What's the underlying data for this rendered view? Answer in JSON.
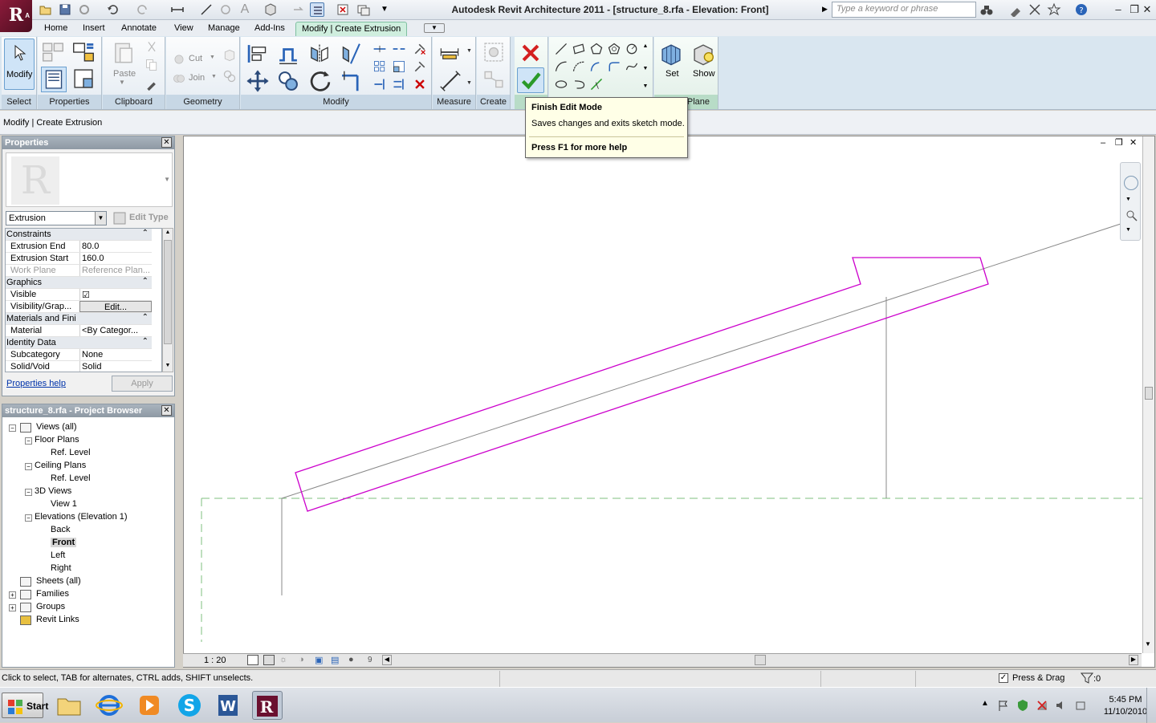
{
  "window": {
    "title": "Autodesk Revit Architecture 2011 - [structure_8.rfa - Elevation: Front]",
    "search_placeholder": "Type a keyword or phrase",
    "logo_letter": "R",
    "logo_sub": "A"
  },
  "tabs": [
    "Home",
    "Insert",
    "Annotate",
    "View",
    "Manage",
    "Add-Ins",
    "Modify | Create Extrusion"
  ],
  "ribbon": {
    "panels": [
      "Select",
      "Properties",
      "Clipboard",
      "Geometry",
      "Modify",
      "Measure",
      "Create",
      "M",
      "Plane"
    ],
    "labels": {
      "modify": "Modify",
      "paste": "Paste",
      "cut": "Cut",
      "join": "Join",
      "set": "Set",
      "show": "Show"
    }
  },
  "tooltip": {
    "title": "Finish Edit Mode",
    "desc": "Saves changes and exits sketch mode.",
    "help": "Press F1 for more help"
  },
  "options_bar": {
    "text": "Modify | Create Extrusion"
  },
  "properties": {
    "title": "Properties",
    "type": "Extrusion",
    "edit_type": "Edit Type",
    "rows": [
      {
        "group": true,
        "k": "Constraints"
      },
      {
        "k": "Extrusion End",
        "v": "80.0"
      },
      {
        "k": "Extrusion Start",
        "v": "160.0"
      },
      {
        "k": "Work Plane",
        "v": "Reference Plan...",
        "dim": true
      },
      {
        "group": true,
        "k": "Graphics"
      },
      {
        "k": "Visible",
        "v": "☑"
      },
      {
        "k": "Visibility/Grap...",
        "v": "Edit..."
      },
      {
        "group": true,
        "k": "Materials and Finishes"
      },
      {
        "k": "Material",
        "v": "<By Categor..."
      },
      {
        "group": true,
        "k": "Identity Data"
      },
      {
        "k": "Subcategory",
        "v": "None"
      },
      {
        "k": "Solid/Void",
        "v": "Solid"
      }
    ],
    "help_link": "Properties help",
    "apply": "Apply"
  },
  "browser": {
    "title": "structure_8.rfa - Project Browser",
    "nodes": [
      {
        "label": "Views (all)",
        "lvl": 0,
        "box": "-"
      },
      {
        "label": "Floor Plans",
        "lvl": 1,
        "box": "-"
      },
      {
        "label": "Ref. Level",
        "lvl": 2
      },
      {
        "label": "Ceiling Plans",
        "lvl": 1,
        "box": "-"
      },
      {
        "label": "Ref. Level",
        "lvl": 2
      },
      {
        "label": "3D Views",
        "lvl": 1,
        "box": "-"
      },
      {
        "label": "View 1",
        "lvl": 2
      },
      {
        "label": "Elevations (Elevation 1)",
        "lvl": 1,
        "box": "-"
      },
      {
        "label": "Back",
        "lvl": 2
      },
      {
        "label": "Front",
        "lvl": 2,
        "sel": true
      },
      {
        "label": "Left",
        "lvl": 2
      },
      {
        "label": "Right",
        "lvl": 2
      },
      {
        "label": "Sheets (all)",
        "lvl": 0
      },
      {
        "label": "Families",
        "lvl": 0,
        "box": "+"
      },
      {
        "label": "Groups",
        "lvl": 0,
        "box": "+"
      },
      {
        "label": "Revit Links",
        "lvl": 0
      }
    ]
  },
  "view": {
    "scale": "1 : 20",
    "hidden_count": "9"
  },
  "status": {
    "text": "Click to select, TAB for alternates, CTRL adds, SHIFT unselects.",
    "press_drag": "Press & Drag",
    "filter": ":0"
  },
  "taskbar": {
    "start": "Start",
    "time": "5:45 PM",
    "date": "11/10/2010"
  },
  "colors": {
    "sketch": "#cc00cc",
    "ref": "#888888",
    "dash": "#7fbf7f",
    "accent": "#cfeede"
  }
}
